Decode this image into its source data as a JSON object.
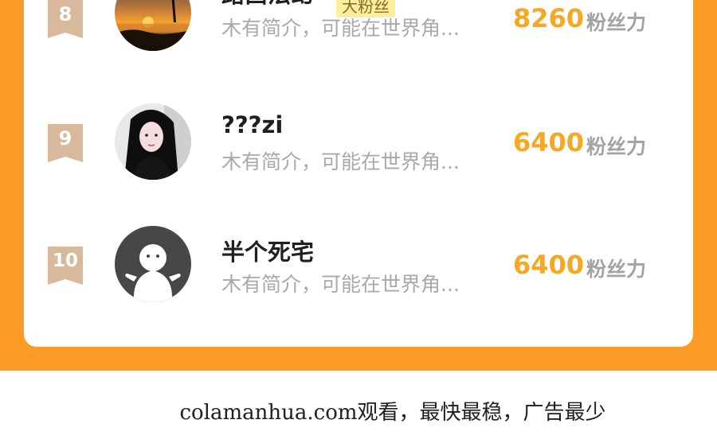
{
  "leaderboard": {
    "score_unit": "粉丝力",
    "rows": [
      {
        "rank": "8",
        "name": "路西法幻",
        "tag": "大粉丝",
        "bio": "木有简介，可能在世界角...",
        "score": "8260",
        "avatar": "sunset-photo-avatar"
      },
      {
        "rank": "9",
        "name": "???zi",
        "bio": "木有简介，可能在世界角...",
        "score": "6400",
        "avatar": "girl-portrait-avatar"
      },
      {
        "rank": "10",
        "name": "半个死宅",
        "bio": "木有简介，可能在世界角...",
        "score": "6400",
        "avatar": "default-ghost-avatar"
      }
    ]
  },
  "footer": {
    "watermark": "colamanhua.com观看，最快最稳，广告最少"
  },
  "colors": {
    "accent_orange": "#FC9C26",
    "score_orange": "#F7A823",
    "rank_badge": "#D8B99C",
    "fan_tag_bg": "#FBEF9D"
  }
}
